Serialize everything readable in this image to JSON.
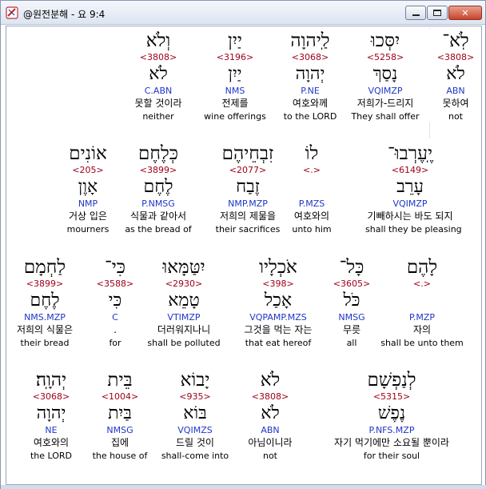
{
  "window": {
    "title": "@원전분해 - 요 9:4",
    "controls": {
      "minimize": "▭",
      "maximize": "□",
      "close": "✕"
    }
  },
  "rows": [
    {
      "words": [
        {
          "heb": "לֹֽא־",
          "strong": "<3808>",
          "root": "לֹא",
          "parse": "ABN",
          "korean": "못하여",
          "english": "not",
          "selected": true
        },
        {
          "heb": "יִסְּכוּ",
          "strong": "<5258>",
          "root": "נָסַךְ",
          "parse": "VQIMZP",
          "korean": "저희가-드리지",
          "english": "They shall offer"
        },
        {
          "heb": "לַֽיהוָה",
          "strong": "<3068>",
          "root": "יְהוָה",
          "parse": "P.NE",
          "korean": "여호와께",
          "english": "to the LORD"
        },
        {
          "heb": "יַיִן",
          "strong": "<3196>",
          "root": "יַיִן",
          "parse": "NMS",
          "korean": "전제를",
          "english": "wine offerings"
        },
        {
          "heb": "וְלֹא",
          "strong": "<3808>",
          "root": "לֹא",
          "parse": "C.ABN",
          "korean": "못할 것이라",
          "english": "neither"
        }
      ]
    },
    {
      "words": [
        {
          "heb": "יֶֽעֶרְבוּ־",
          "strong": "<6149>",
          "root": "עָרֵב",
          "parse": "VQIMZP",
          "korean": "기빼하시는 바도 되지",
          "english": "shall they be pleasing"
        },
        {
          "heb": "לוֹ",
          "strong": "<.>",
          "root": "",
          "parse": "P.MZS",
          "korean": "여호와의",
          "english": "unto him"
        },
        {
          "heb": "זִבְחֵיהֶם",
          "strong": "<2077>",
          "root": "זֶבַח",
          "parse": "NMP.MZP",
          "korean": "저희의 제물을",
          "english": "their sacrifices"
        },
        {
          "heb": "כְּלֶחֶם",
          "strong": "<3899>",
          "root": "לֶחֶם",
          "parse": "P.NMSG",
          "korean": "식물과 같아서",
          "english": "as the bread of"
        },
        {
          "heb": "אוֹנִים",
          "strong": "<205>",
          "root": "אָוֶן",
          "parse": "NMP",
          "korean": "거상 입은",
          "english": "mourners"
        }
      ]
    },
    {
      "words": [
        {
          "heb": "לָהֶם",
          "strong": "<.>",
          "root": "",
          "parse": "P.MZP",
          "korean": "자의",
          "english": "shall be unto them"
        },
        {
          "heb": "כָּל־",
          "strong": "<3605>",
          "root": "כֹּל",
          "parse": "NMSG",
          "korean": "무릇",
          "english": "all"
        },
        {
          "heb": "אֹכְלָיו",
          "strong": "<398>",
          "root": "אָכַל",
          "parse": "VQPAMP.MZS",
          "korean": "그것을 먹는 자는",
          "english": "that eat hereof"
        },
        {
          "heb": "יִטַּמָּאוּ",
          "strong": "<2930>",
          "root": "טָמֵא",
          "parse": "VTIMZP",
          "korean": "더러워지나니",
          "english": "shall be polluted"
        },
        {
          "heb": "כִּי־",
          "strong": "<3588>",
          "root": "כִּי",
          "parse": "C",
          "korean": ".",
          "english": "for"
        },
        {
          "heb": "לַחְמָם",
          "strong": "<3899>",
          "root": "לֶחֶם",
          "parse": "NMS.MZP",
          "korean": "저희의 식물은",
          "english": "their bread"
        }
      ]
    },
    {
      "words": [
        {
          "heb": "לְנַפְשָׁם",
          "strong": "<5315>",
          "root": "נֶפֶשׁ",
          "parse": "P.NFS.MZP",
          "korean": "자기 먹기에만 소요될 뿐이라",
          "english": "for their soul"
        },
        {
          "heb": "לֹא",
          "strong": "<3808>",
          "root": "לֹא",
          "parse": "ABN",
          "korean": "아님이니라",
          "english": "not"
        },
        {
          "heb": "יָבוֹא",
          "strong": "<935>",
          "root": "בּוֹא",
          "parse": "VQIMZS",
          "korean": "드릴 것이",
          "english": "shall-come into"
        },
        {
          "heb": "בֵּית",
          "strong": "<1004>",
          "root": "בַּיִת",
          "parse": "NMSG",
          "korean": "집에",
          "english": "the house of"
        },
        {
          "heb": "יְהוָֽה׃",
          "strong": "<3068>",
          "root": "יְהוָה",
          "parse": "NE",
          "korean": "여호와의",
          "english": "the LORD"
        }
      ]
    }
  ]
}
